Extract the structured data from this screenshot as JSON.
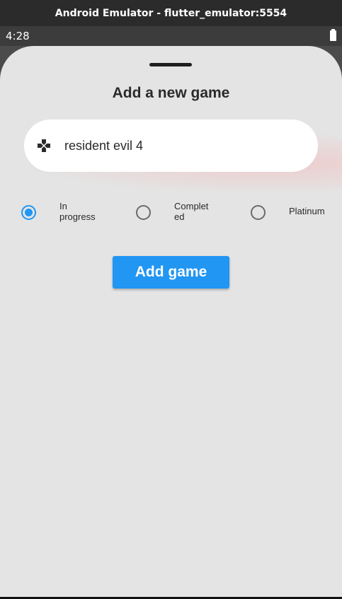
{
  "window": {
    "title": "Android Emulator - flutter_emulator:5554"
  },
  "status_bar": {
    "time": "4:28",
    "battery_icon": "battery-full-icon"
  },
  "sheet": {
    "title": "Add a new game",
    "input": {
      "icon": "gamepad-icon",
      "value": "resident evil 4"
    },
    "status_options": [
      {
        "label_line1": "In",
        "label_line2": "progress",
        "selected": true
      },
      {
        "label_line1": "Complet",
        "label_line2": "ed",
        "selected": false
      },
      {
        "label_line1": "Platinum",
        "label_line2": "",
        "selected": false
      }
    ],
    "add_button_label": "Add game"
  },
  "colors": {
    "accent": "#2196f3",
    "sheet_background": "#e4e4e4",
    "title_bar": "#2b2b2b"
  }
}
